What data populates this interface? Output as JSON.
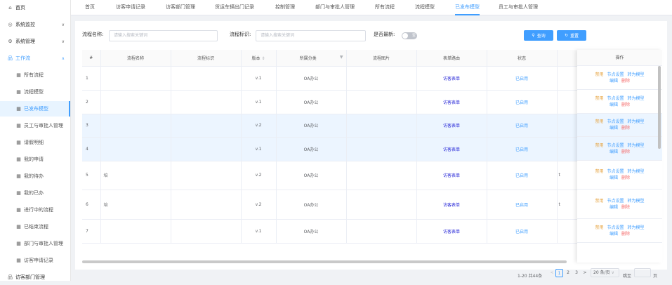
{
  "sidebar": {
    "items": [
      {
        "label": "首页",
        "icon": "home-icon"
      },
      {
        "label": "系统监控",
        "icon": "monitor-icon"
      },
      {
        "label": "系统管理",
        "icon": "gear-icon"
      },
      {
        "label": "工作流",
        "icon": "workflow-icon"
      },
      {
        "label": "所有流程",
        "icon": "list-icon"
      },
      {
        "label": "流程模型",
        "icon": "list-icon"
      },
      {
        "label": "已发布模型",
        "icon": "list-icon"
      },
      {
        "label": "员工与审批人管理",
        "icon": "list-icon"
      },
      {
        "label": "请假明细",
        "icon": "list-icon"
      },
      {
        "label": "我的申请",
        "icon": "list-icon"
      },
      {
        "label": "我的待办",
        "icon": "list-icon"
      },
      {
        "label": "我的已办",
        "icon": "list-icon"
      },
      {
        "label": "进行中的流程",
        "icon": "list-icon"
      },
      {
        "label": "已结束流程",
        "icon": "list-icon"
      },
      {
        "label": "部门与审批人管理",
        "icon": "list-icon"
      },
      {
        "label": "访客申请记录",
        "icon": "list-icon"
      },
      {
        "label": "访客部门管理",
        "icon": "workflow-icon"
      }
    ]
  },
  "tabs": [
    "首页",
    "访客申请记录",
    "访客部门管理",
    "货运车辆出门记录",
    "控制管理",
    "部门与审批人管理",
    "所有流程",
    "流程模型",
    "已发布模型",
    "员工与审批人管理"
  ],
  "active_tab": "已发布模型",
  "search": {
    "name_label": "流程名称:",
    "name_placeholder": "请输入搜索关键词",
    "key_label": "流程标识:",
    "key_placeholder": "请输入搜索关键词",
    "latest_label": "是否最新:",
    "switch_text": "否",
    "query_label": "查询",
    "reset_label": "重置"
  },
  "table": {
    "headers": [
      "#",
      "流程名称",
      "流程标识",
      "版本",
      "所属分类",
      "流程图片",
      "表单路由",
      "状态"
    ],
    "sort_glyph": "⇕",
    "filter_glyph": "▼",
    "ops_header": "操作",
    "rows": [
      {
        "index": "1",
        "name_prefix": "",
        "version": "v.1",
        "category": "OA办公",
        "route": "访客表单",
        "status": "已启用",
        "extra": ""
      },
      {
        "index": "2",
        "name_prefix": "",
        "version": "v.1",
        "category": "OA办公",
        "route": "访客表单",
        "status": "已启用",
        "extra": ""
      },
      {
        "index": "3",
        "name_prefix": "",
        "version": "v.2",
        "category": "OA办公",
        "route": "访客表单",
        "status": "已启用",
        "extra": ""
      },
      {
        "index": "4",
        "name_prefix": "",
        "version": "v.1",
        "category": "OA办公",
        "route": "访客表单",
        "status": "已启用",
        "extra": ""
      },
      {
        "index": "5",
        "name_prefix": "培",
        "version": "v.2",
        "category": "OA办公",
        "route": "访客表单",
        "status": "已启用",
        "extra": "t"
      },
      {
        "index": "6",
        "name_prefix": "培",
        "version": "v.2",
        "category": "OA办公",
        "route": "访客表单",
        "status": "已启用",
        "extra": "t"
      },
      {
        "index": "7",
        "name_prefix": "",
        "version": "v.1",
        "category": "OA办公",
        "route": "访客表单",
        "status": "已启用",
        "extra": ""
      }
    ],
    "actions": {
      "disable": "禁用",
      "node": "节点设置",
      "to_model": "转为模型",
      "edit": "编辑",
      "delete": "删除"
    }
  },
  "pagination": {
    "summary": "1-20 共44条",
    "prev": "<",
    "pages": [
      "1",
      "2",
      "3"
    ],
    "current": "1",
    "next": ">",
    "page_size": "20 条/页",
    "page_size_arrow": "∨",
    "jump_label": "跳至",
    "page_unit": "页"
  },
  "colors": {
    "accent": "#409eff",
    "warning": "#e6a23c",
    "danger": "#f56c6c",
    "route_link": "#1f1fd6"
  }
}
